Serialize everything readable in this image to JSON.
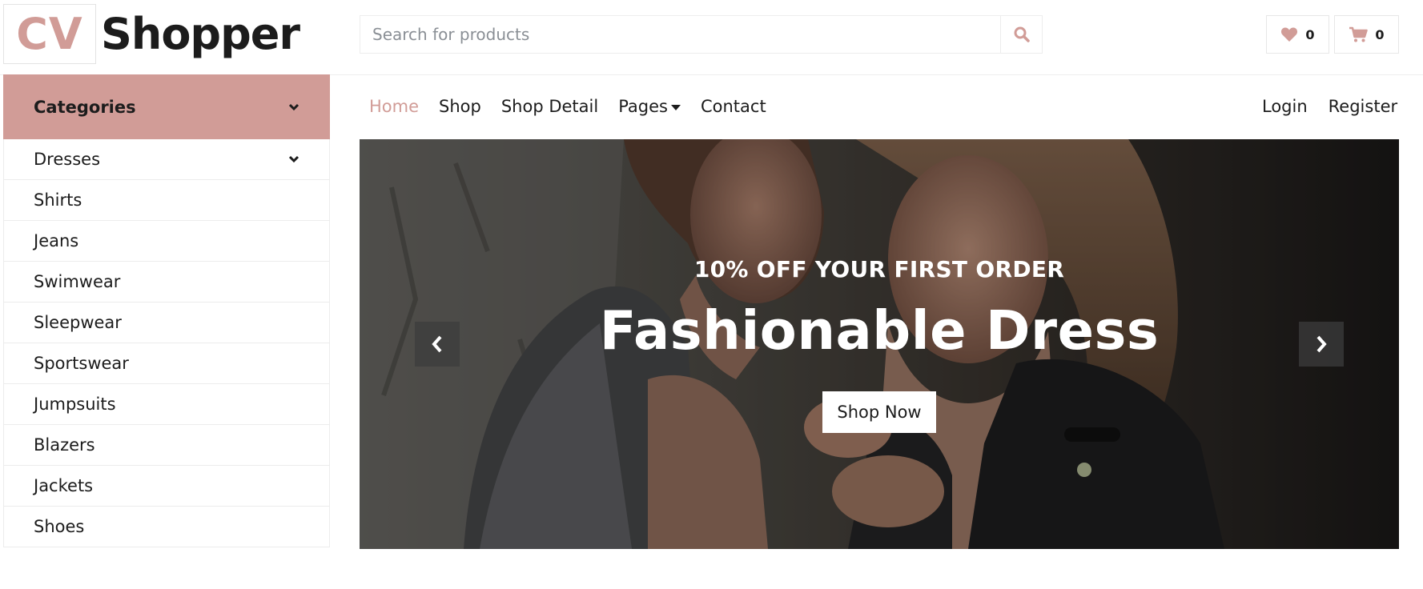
{
  "brand": {
    "mark": "CV",
    "name": "Shopper",
    "accent_color": "#d19c97"
  },
  "search": {
    "placeholder": "Search for products",
    "icon": "search-icon"
  },
  "header_actions": {
    "wishlist": {
      "icon": "heart-icon",
      "count": "0"
    },
    "cart": {
      "icon": "cart-icon",
      "count": "0"
    }
  },
  "sidebar": {
    "title": "Categories",
    "items": [
      {
        "label": "Dresses",
        "has_submenu": true
      },
      {
        "label": "Shirts"
      },
      {
        "label": "Jeans"
      },
      {
        "label": "Swimwear"
      },
      {
        "label": "Sleepwear"
      },
      {
        "label": "Sportswear"
      },
      {
        "label": "Jumpsuits"
      },
      {
        "label": "Blazers"
      },
      {
        "label": "Jackets"
      },
      {
        "label": "Shoes"
      }
    ]
  },
  "nav": {
    "items": [
      {
        "label": "Home",
        "active": true
      },
      {
        "label": "Shop"
      },
      {
        "label": "Shop Detail"
      },
      {
        "label": "Pages",
        "dropdown": true
      },
      {
        "label": "Contact"
      }
    ],
    "right": {
      "login": "Login",
      "register": "Register"
    }
  },
  "hero": {
    "subtitle": "10% OFF YOUR FIRST ORDER",
    "title": "Fashionable Dress",
    "button": "Shop Now",
    "prev_icon": "chevron-left-icon",
    "next_icon": "chevron-right-icon"
  }
}
